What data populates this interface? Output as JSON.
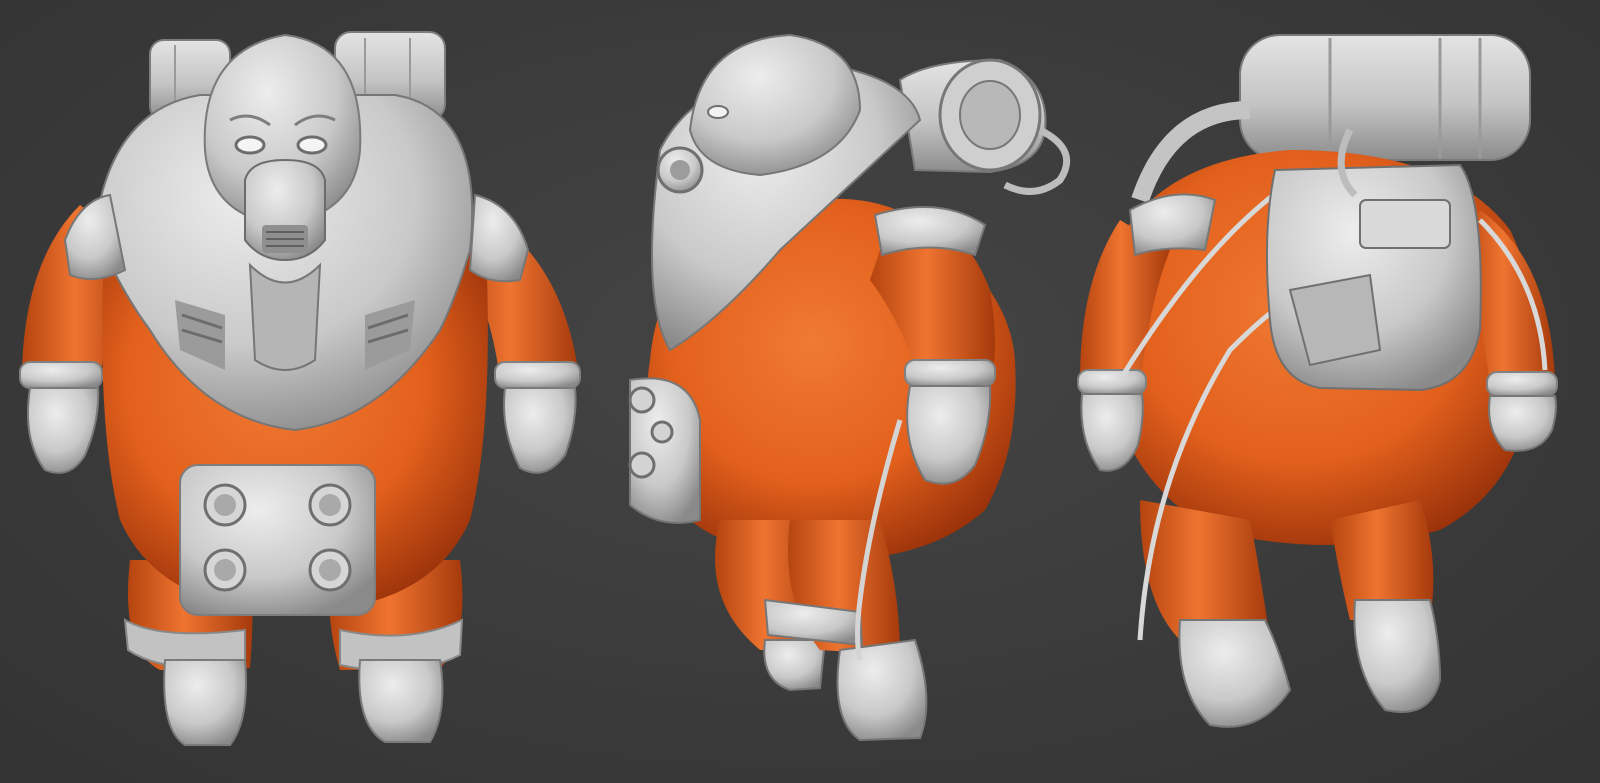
{
  "scene": {
    "subject": "",
    "views": [
      {
        "view": "front",
        "icon": "astronaut-front"
      },
      {
        "view": "side",
        "icon": "astronaut-side"
      },
      {
        "view": "back",
        "icon": "astronaut-back"
      }
    ],
    "colors": {
      "background": "#3b3b3b",
      "suit": "#e2601c",
      "suit_shadow": "#a8380b",
      "armor": "#c9c9c9",
      "armor_shadow": "#8f8f8f",
      "armor_highlight": "#e6e6e6"
    }
  }
}
